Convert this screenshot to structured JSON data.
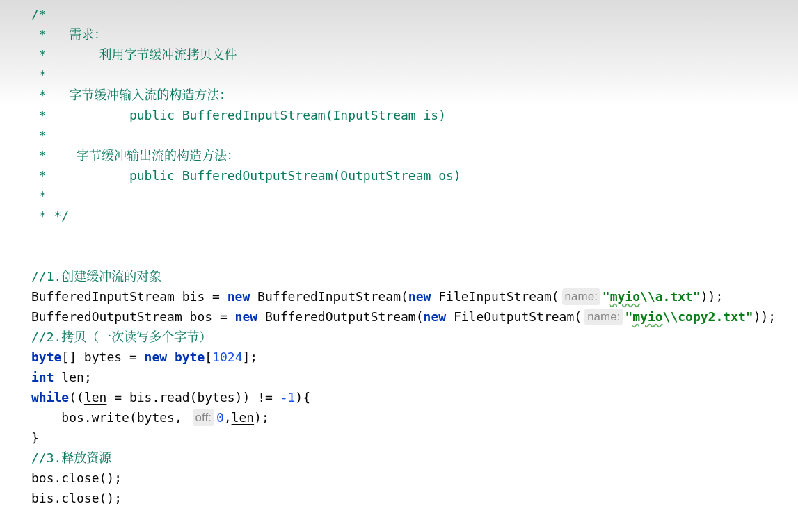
{
  "editor": {
    "lines": [
      {
        "kind": "code",
        "tokens": [
          {
            "kind": "comment",
            "text": "/*"
          }
        ]
      },
      {
        "kind": "code",
        "tokens": [
          {
            "kind": "comment",
            "text": " *   需求："
          }
        ]
      },
      {
        "kind": "code",
        "tokens": [
          {
            "kind": "comment",
            "text": " *       利用字节缓冲流拷贝文件"
          }
        ]
      },
      {
        "kind": "code",
        "tokens": [
          {
            "kind": "comment",
            "text": " *"
          }
        ]
      },
      {
        "kind": "code",
        "tokens": [
          {
            "kind": "comment",
            "text": " *   字节缓冲输入流的构造方法："
          }
        ]
      },
      {
        "kind": "code",
        "tokens": [
          {
            "kind": "comment",
            "text": " *           public BufferedInputStream(InputStream is)"
          }
        ]
      },
      {
        "kind": "code",
        "tokens": [
          {
            "kind": "comment",
            "text": " *"
          }
        ]
      },
      {
        "kind": "code",
        "tokens": [
          {
            "kind": "comment",
            "text": " *    字节缓冲输出流的构造方法："
          }
        ]
      },
      {
        "kind": "code",
        "tokens": [
          {
            "kind": "comment",
            "text": " *           public BufferedOutputStream(OutputStream os)"
          }
        ]
      },
      {
        "kind": "code",
        "tokens": [
          {
            "kind": "comment",
            "text": " *"
          }
        ]
      },
      {
        "kind": "code",
        "tokens": [
          {
            "kind": "comment",
            "text": " * */"
          }
        ]
      },
      {
        "kind": "blank"
      },
      {
        "kind": "blank"
      },
      {
        "kind": "code",
        "tokens": [
          {
            "kind": "comment",
            "text": "//1.创建缓冲流的对象"
          }
        ]
      },
      {
        "kind": "code",
        "tokens": [
          {
            "kind": "plain",
            "text": "BufferedInputStream bis = "
          },
          {
            "kind": "keyword",
            "text": "new"
          },
          {
            "kind": "plain",
            "text": " BufferedInputStream("
          },
          {
            "kind": "keyword",
            "text": "new"
          },
          {
            "kind": "plain",
            "text": " FileInputStream("
          },
          {
            "kind": "hint",
            "text": "name:"
          },
          {
            "kind": "string",
            "text": "\""
          },
          {
            "kind": "typo",
            "text": "myio"
          },
          {
            "kind": "string",
            "text": "\\\\a.txt\""
          },
          {
            "kind": "plain",
            "text": "));"
          }
        ]
      },
      {
        "kind": "code",
        "tokens": [
          {
            "kind": "plain",
            "text": "BufferedOutputStream bos = "
          },
          {
            "kind": "keyword",
            "text": "new"
          },
          {
            "kind": "plain",
            "text": " BufferedOutputStream("
          },
          {
            "kind": "keyword",
            "text": "new"
          },
          {
            "kind": "plain",
            "text": " FileOutputStream("
          },
          {
            "kind": "hint",
            "text": "name:"
          },
          {
            "kind": "string",
            "text": "\""
          },
          {
            "kind": "typo",
            "text": "myio"
          },
          {
            "kind": "string",
            "text": "\\\\copy2.txt\""
          },
          {
            "kind": "plain",
            "text": "));"
          }
        ]
      },
      {
        "kind": "code",
        "tokens": [
          {
            "kind": "comment",
            "text": "//2.拷贝（一次读写多个字节）"
          }
        ]
      },
      {
        "kind": "code",
        "tokens": [
          {
            "kind": "keyword",
            "text": "byte"
          },
          {
            "kind": "plain",
            "text": "[] bytes = "
          },
          {
            "kind": "keyword",
            "text": "new byte"
          },
          {
            "kind": "plain",
            "text": "["
          },
          {
            "kind": "number",
            "text": "1024"
          },
          {
            "kind": "plain",
            "text": "];"
          }
        ]
      },
      {
        "kind": "code",
        "tokens": [
          {
            "kind": "keyword",
            "text": "int "
          },
          {
            "kind": "var",
            "text": "len"
          },
          {
            "kind": "plain",
            "text": ";"
          }
        ]
      },
      {
        "kind": "code",
        "tokens": [
          {
            "kind": "keyword",
            "text": "while"
          },
          {
            "kind": "plain",
            "text": "(("
          },
          {
            "kind": "var",
            "text": "len"
          },
          {
            "kind": "plain",
            "text": " = bis.read(bytes)) != "
          },
          {
            "kind": "number",
            "text": "-1"
          },
          {
            "kind": "plain",
            "text": "){"
          }
        ]
      },
      {
        "kind": "code",
        "tokens": [
          {
            "kind": "plain",
            "text": "    bos.write(bytes, "
          },
          {
            "kind": "hint",
            "text": "off:"
          },
          {
            "kind": "number",
            "text": "0"
          },
          {
            "kind": "plain",
            "text": ","
          },
          {
            "kind": "var",
            "text": "len"
          },
          {
            "kind": "plain",
            "text": ");"
          }
        ]
      },
      {
        "kind": "code",
        "tokens": [
          {
            "kind": "plain",
            "text": "}"
          }
        ]
      },
      {
        "kind": "code",
        "tokens": [
          {
            "kind": "comment",
            "text": "//3.释放资源"
          }
        ]
      },
      {
        "kind": "code",
        "tokens": [
          {
            "kind": "plain",
            "text": "bos.close();"
          }
        ]
      },
      {
        "kind": "code",
        "tokens": [
          {
            "kind": "plain",
            "text": "bis.close();"
          }
        ]
      }
    ]
  }
}
